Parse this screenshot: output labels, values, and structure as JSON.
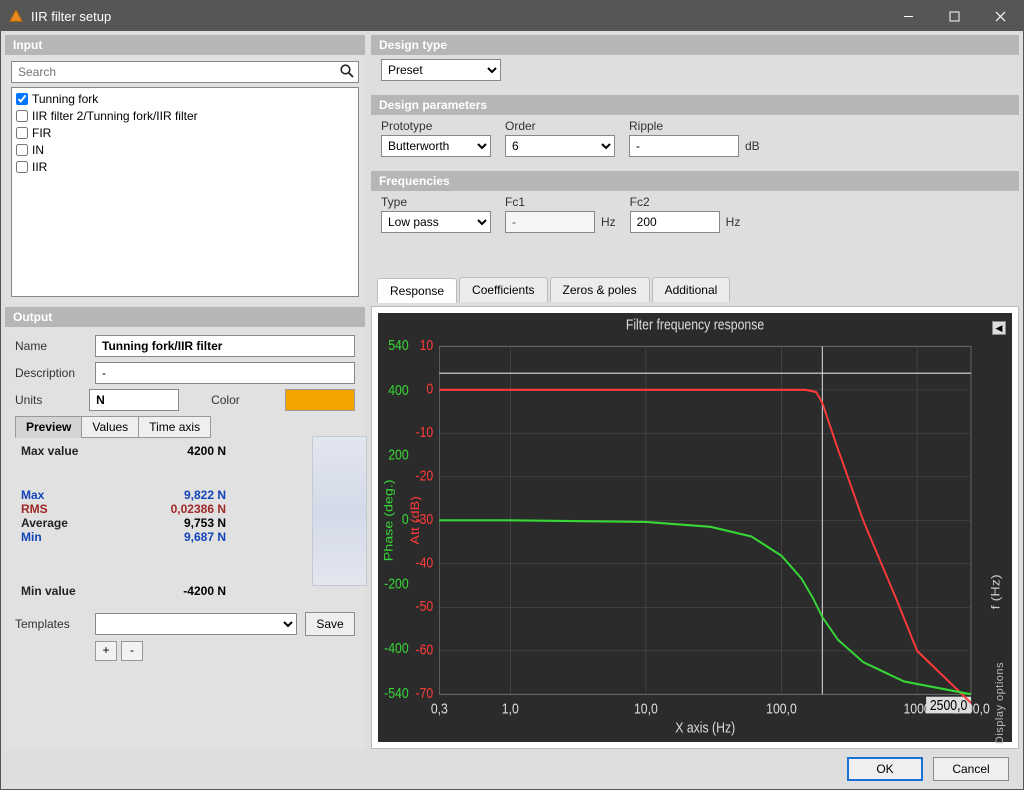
{
  "titlebar": {
    "title": "IIR filter setup"
  },
  "sections": {
    "input": "Input",
    "output": "Output",
    "design_type": "Design type",
    "design_params": "Design parameters",
    "frequencies": "Frequencies"
  },
  "search": {
    "placeholder": "Search"
  },
  "input_items": [
    {
      "label": "Tunning fork",
      "checked": true
    },
    {
      "label": "IIR filter 2/Tunning fork/IIR filter",
      "checked": false
    },
    {
      "label": "FIR",
      "checked": false
    },
    {
      "label": "IN",
      "checked": false
    },
    {
      "label": "IIR",
      "checked": false
    }
  ],
  "output": {
    "name_label": "Name",
    "name_value": "Tunning fork/IIR filter",
    "desc_label": "Description",
    "desc_value": "-",
    "units_label": "Units",
    "units_value": "N",
    "color_label": "Color",
    "color": "#f4a300",
    "tabs": {
      "preview": "Preview",
      "values": "Values",
      "timeaxis": "Time axis"
    },
    "stats": {
      "max_value_label": "Max value",
      "max_value": "4200 N",
      "max_label": "Max",
      "max": "9,822 N",
      "rms_label": "RMS",
      "rms": "0,02386 N",
      "avg_label": "Average",
      "avg": "9,753 N",
      "min_label": "Min",
      "min": "9,687 N",
      "min_value_label": "Min value",
      "min_value": "-4200 N"
    },
    "templates_label": "Templates",
    "save_label": "Save",
    "add": "+",
    "remove": "-"
  },
  "design": {
    "preset": "Preset",
    "prototype_label": "Prototype",
    "prototype": "Butterworth",
    "order_label": "Order",
    "order": "6",
    "ripple_label": "Ripple",
    "ripple": "-",
    "ripple_unit": "dB",
    "type_label": "Type",
    "type": "Low pass",
    "fc1_label": "Fc1",
    "fc1": "-",
    "fc1_unit": "Hz",
    "fc2_label": "Fc2",
    "fc2": "200",
    "fc2_unit": "Hz"
  },
  "result_tabs": {
    "response": "Response",
    "coeffs": "Coefficients",
    "zeros": "Zeros & poles",
    "additional": "Additional"
  },
  "buttons": {
    "ok": "OK",
    "cancel": "Cancel"
  },
  "chart_data": {
    "type": "line",
    "title": "Filter frequency response",
    "xlabel": "X axis (Hz)",
    "x_scale": "log",
    "xlim": [
      0.3,
      2500
    ],
    "x_ticks": [
      "0,3",
      "1,0",
      "10,0",
      "100,0",
      "1000",
      "2500,0"
    ],
    "y_left": {
      "label": "Phase (deg.)",
      "color": "#37d637",
      "range": [
        -540,
        540
      ],
      "ticks": [
        -540,
        -400,
        -200,
        0,
        200,
        400,
        540
      ]
    },
    "y_right": {
      "label": "Att (dB)",
      "color": "#ff3a3a",
      "range": [
        -70,
        10
      ],
      "ticks": [
        -70,
        -60,
        -50,
        -40,
        -30,
        -20,
        -10,
        0,
        10
      ],
      "unit": "f (Hz)"
    },
    "series": [
      {
        "name": "Attenuation (dB)",
        "color": "#ff3a3a",
        "x": [
          0.3,
          1,
          10,
          50,
          100,
          150,
          180,
          200,
          250,
          400,
          700,
          1000,
          2500
        ],
        "y": [
          0,
          0,
          0,
          0,
          0,
          0,
          -0.5,
          -3,
          -12,
          -30,
          -48,
          -60,
          -72
        ]
      },
      {
        "name": "Phase (deg.)",
        "color": "#37d637",
        "x": [
          0.3,
          1,
          10,
          30,
          60,
          100,
          140,
          170,
          200,
          260,
          400,
          800,
          2500
        ],
        "y": [
          0,
          0,
          -5,
          -20,
          -50,
          -110,
          -180,
          -240,
          -300,
          -370,
          -440,
          -500,
          -540
        ]
      }
    ],
    "cursor_x": 200,
    "cursor_y_at_readout": 2500.0,
    "side_panel_label": "Display options"
  }
}
